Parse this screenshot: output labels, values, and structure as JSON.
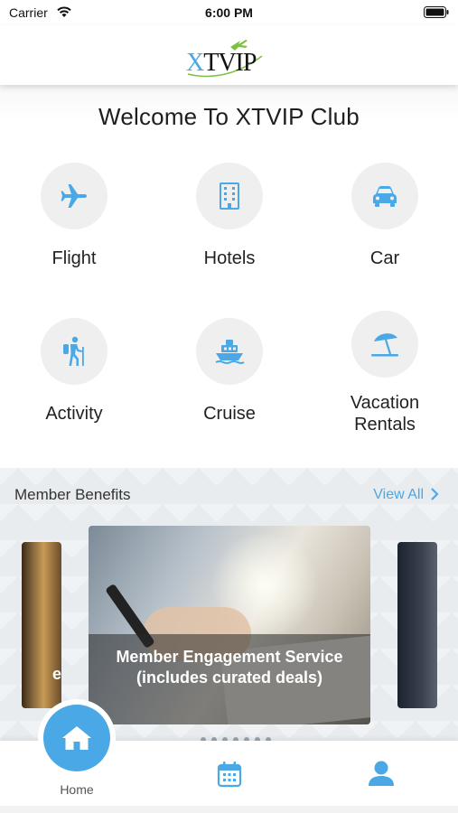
{
  "status_bar": {
    "carrier": "Carrier",
    "time": "6:00 PM"
  },
  "header": {
    "logo_text": "XTVIP"
  },
  "welcome": "Welcome To XTVIP Club",
  "services": [
    {
      "label": "Flight",
      "icon": "airplane-icon"
    },
    {
      "label": "Hotels",
      "icon": "building-icon"
    },
    {
      "label": "Car",
      "icon": "car-icon"
    },
    {
      "label": "Activity",
      "icon": "hiker-icon"
    },
    {
      "label": "Cruise",
      "icon": "ship-icon"
    },
    {
      "label": "Vacation\nRentals",
      "icon": "beach-umbrella-icon"
    }
  ],
  "benefits": {
    "title": "Member Benefits",
    "view_all": "View All",
    "cards": [
      {
        "caption": "e"
      },
      {
        "caption": "Member Engagement Service (includes curated deals)"
      }
    ]
  },
  "tabbar": {
    "home_label": "Home"
  },
  "colors": {
    "accent": "#4aa8e6",
    "logo_green": "#7cc242"
  }
}
